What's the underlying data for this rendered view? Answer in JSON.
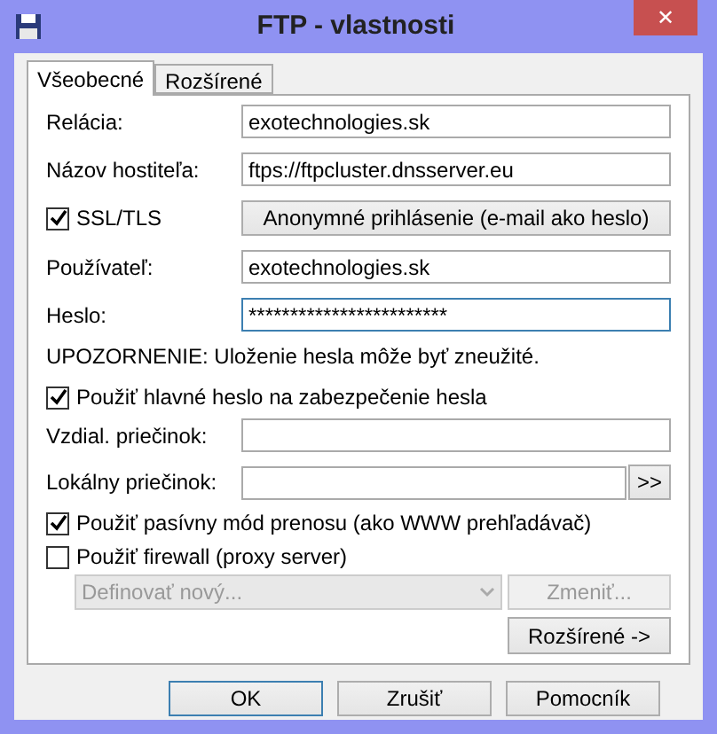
{
  "window": {
    "title": "FTP - vlastnosti",
    "close": "✕"
  },
  "tabs": [
    {
      "label": "Všeobecné",
      "selected": true
    },
    {
      "label": "Rozšírené",
      "selected": false
    }
  ],
  "session": {
    "label": "Relácia:",
    "value": "exotechnologies.sk"
  },
  "host": {
    "label": "Názov hostiteľa:",
    "value": "ftps://ftpcluster.dnsserver.eu"
  },
  "ssl": {
    "label": "SSL/TLS",
    "checked": true
  },
  "anonymous_button": "Anonymné prihlásenie (e-mail ako heslo)",
  "user": {
    "label": "Používateľ:",
    "value": "exotechnologies.sk"
  },
  "password": {
    "label": "Heslo:",
    "value": "************************",
    "focused": true
  },
  "warning": "UPOZORNENIE: Uloženie hesla môže byť zneužité.",
  "master_password": {
    "label": "Použiť hlavné heslo na zabezpečenie hesla",
    "checked": true
  },
  "remote_folder": {
    "label": "Vzdial. priečinok:"
  },
  "local_folder": {
    "label": "Lokálny priečinok:",
    "browse": ">>"
  },
  "passive": {
    "label": "Použiť pasívny mód prenosu (ako WWW prehľadávač)",
    "checked": true
  },
  "firewall": {
    "label": "Použiť firewall (proxy server)",
    "checked": false
  },
  "proxy": {
    "value": "Definovať nový...",
    "disabled": true,
    "change_button": "Zmeniť..."
  },
  "advanced_button": "Rozšírené ->",
  "buttons": [
    {
      "label": "OK",
      "default": true
    },
    {
      "label": "Zrušiť",
      "default": false
    },
    {
      "label": "Pomocník",
      "default": false
    }
  ]
}
